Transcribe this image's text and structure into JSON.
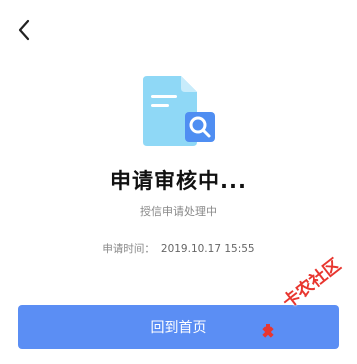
{
  "nav": {
    "back_icon": "chevron-left-icon"
  },
  "illustration": {
    "icon": "document-search-icon",
    "colors": {
      "paper": "#8fd8f6",
      "paper_fold": "#c8ecfb",
      "magnifier_bg": "#4f8ef2",
      "lines": "#ffffff"
    }
  },
  "status": {
    "title": "申请审核中...",
    "subtitle": "授信申请处理中",
    "time_label": "申请时间：",
    "time_value": "2019.10.17 15:55"
  },
  "actions": {
    "home_button_label": "回到首页"
  },
  "watermark": {
    "text": "卡农社区",
    "color": "#e8362f"
  },
  "colors": {
    "accent": "#5b8ef4",
    "title": "#111111",
    "muted": "#888888"
  }
}
